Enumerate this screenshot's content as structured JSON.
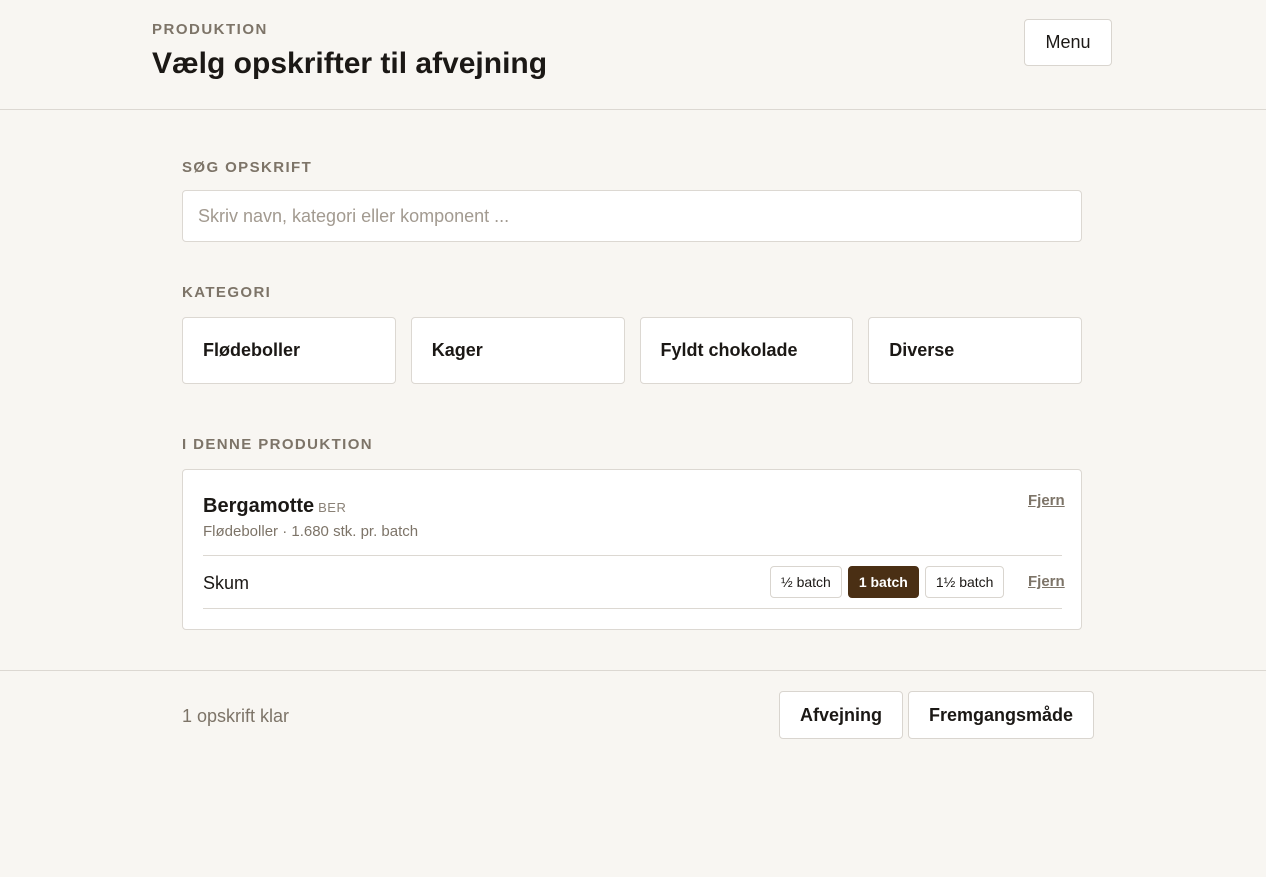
{
  "header": {
    "eyebrow": "PRODUKTION",
    "title": "Vælg opskrifter til afvejning",
    "menu_label": "Menu"
  },
  "search": {
    "label": "SØG OPSKRIFT",
    "placeholder": "Skriv navn, kategori eller komponent ...",
    "value": ""
  },
  "categories": {
    "label": "KATEGORI",
    "items": [
      "Flødeboller",
      "Kager",
      "Fyldt chokolade",
      "Diverse"
    ]
  },
  "production": {
    "label": "I DENNE PRODUKTION",
    "recipes": [
      {
        "name": "Bergamotte",
        "code": "BER",
        "meta": "Flødeboller · 1.680 stk. pr. batch",
        "remove_label": "Fjern",
        "components": [
          {
            "name": "Skum",
            "batch_options": [
              "½ batch",
              "1 batch",
              "1½ batch"
            ],
            "selected_batch": "1 batch",
            "remove_label": "Fjern"
          }
        ]
      }
    ]
  },
  "footer": {
    "status": "1 opskrift klar",
    "weigh_label": "Afvejning",
    "procedure_label": "Fremgangsmåde"
  },
  "colors": {
    "background": "#f8f6f2",
    "accent_active_batch": "#4a2f14",
    "muted_text": "#7d7468",
    "border": "#dcd8d2"
  }
}
